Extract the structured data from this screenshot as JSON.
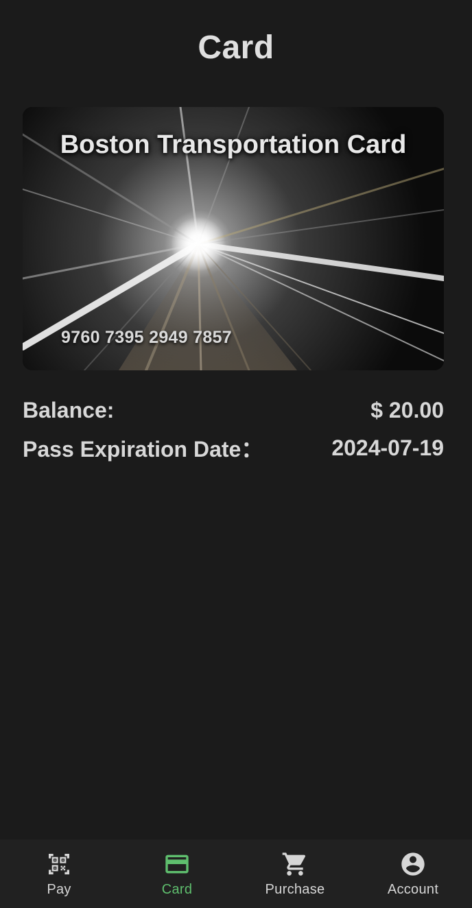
{
  "header": {
    "title": "Card"
  },
  "card": {
    "title": "Boston Transportation Card",
    "number": "9760 7395 2949 7857"
  },
  "details": {
    "balance_label": "Balance:",
    "balance_value": "$ 20.00",
    "expiry_label": "Pass Expiration Date：",
    "expiry_value": "2024-07-19"
  },
  "nav": {
    "items": [
      {
        "label": "Pay",
        "icon": "qr-code-icon",
        "active": false
      },
      {
        "label": "Card",
        "icon": "credit-card-icon",
        "active": true
      },
      {
        "label": "Purchase",
        "icon": "cart-icon",
        "active": false
      },
      {
        "label": "Account",
        "icon": "account-circle-icon",
        "active": false
      }
    ]
  },
  "colors": {
    "background": "#1b1b1b",
    "nav_background": "#212121",
    "accent": "#5fbf6e",
    "text": "#dcdcdc"
  }
}
